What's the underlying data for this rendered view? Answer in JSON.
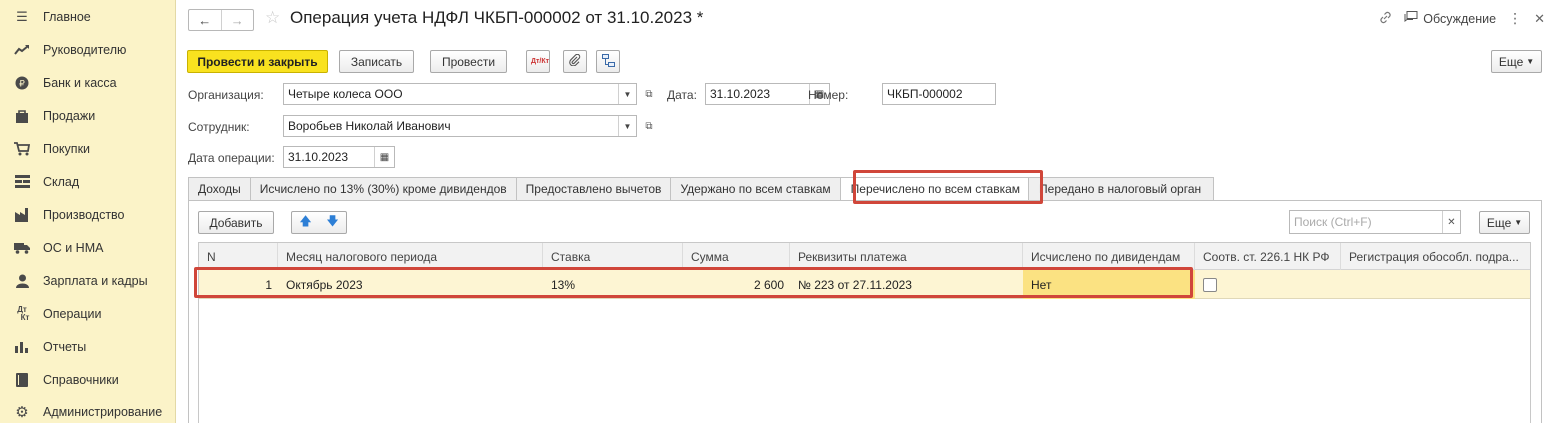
{
  "sidebar": {
    "items": [
      {
        "label": "Главное",
        "icon": "menu-icon"
      },
      {
        "label": "Руководителю",
        "icon": "trend-icon"
      },
      {
        "label": "Банк и касса",
        "icon": "coin-icon"
      },
      {
        "label": "Продажи",
        "icon": "bag-icon"
      },
      {
        "label": "Покупки",
        "icon": "cart-icon"
      },
      {
        "label": "Склад",
        "icon": "warehouse-icon"
      },
      {
        "label": "Производство",
        "icon": "factory-icon"
      },
      {
        "label": "ОС и НМА",
        "icon": "truck-icon"
      },
      {
        "label": "Зарплата и кадры",
        "icon": "person-icon"
      },
      {
        "label": "Операции",
        "icon": "dt-kt-icon"
      },
      {
        "label": "Отчеты",
        "icon": "bar-chart-icon"
      },
      {
        "label": "Справочники",
        "icon": "book-icon"
      },
      {
        "label": "Администрирование",
        "icon": "gear-icon"
      }
    ]
  },
  "header": {
    "title": "Операция учета НДФЛ ЧКБП-000002 от 31.10.2023 *",
    "discussion_label": "Обсуждение"
  },
  "toolbar": {
    "post_close_label": "Провести и закрыть",
    "save_label": "Записать",
    "post_label": "Провести",
    "dtkt_label": "Дт/Кт",
    "more_label": "Еще"
  },
  "form": {
    "org_label": "Организация:",
    "org_value": "Четыре колеса ООО",
    "date_label": "Дата:",
    "date_value": "31.10.2023",
    "number_label": "Номер:",
    "number_value": "ЧКБП-000002",
    "employee_label": "Сотрудник:",
    "employee_value": "Воробьев Николай Иванович",
    "op_date_label": "Дата операции:",
    "op_date_value": "31.10.2023"
  },
  "tabs": [
    {
      "label": "Доходы"
    },
    {
      "label": "Исчислено по 13% (30%) кроме дивидендов"
    },
    {
      "label": "Предоставлено вычетов"
    },
    {
      "label": "Удержано по всем ставкам"
    },
    {
      "label": "Перечислено по всем ставкам"
    },
    {
      "label": "Передано в налоговый орган"
    }
  ],
  "active_tab": "Перечислено по всем ставкам",
  "table_toolbar": {
    "add_label": "Добавить",
    "search_placeholder": "Поиск (Ctrl+F)",
    "more_label": "Еще"
  },
  "table": {
    "columns": [
      "N",
      "Месяц налогового периода",
      "Ставка",
      "Сумма",
      "Реквизиты платежа",
      "Исчислено по дивидендам",
      "Соотв. ст. 226.1 НК РФ",
      "Регистрация обособл. подра..."
    ],
    "rows": [
      {
        "n": "1",
        "month": "Октябрь 2023",
        "rate": "13%",
        "sum": "2 600",
        "payment": "№ 223 от 27.11.2023",
        "dividends": "Нет",
        "art2261": false,
        "registration": ""
      }
    ]
  },
  "colors": {
    "sidebar_bg": "#fbf3c8",
    "primary_button": "#f9e21f",
    "highlight_border": "#d0463a",
    "selected_row": "#fdf5d3"
  }
}
